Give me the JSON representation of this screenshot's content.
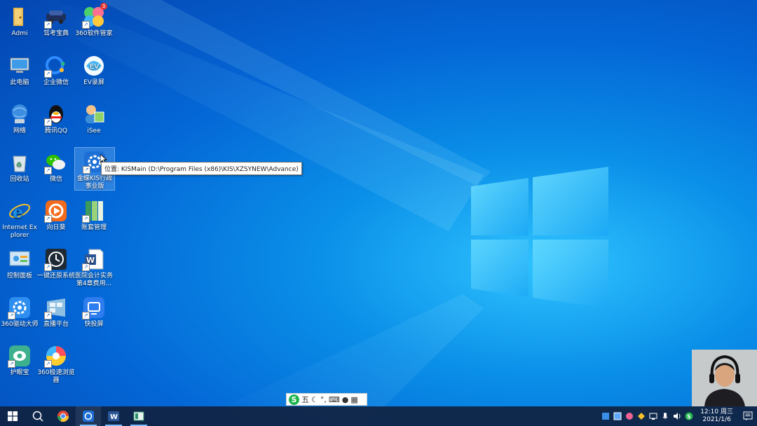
{
  "desktop": {
    "icons": [
      {
        "id": "admin",
        "label": "Admi"
      },
      {
        "id": "jiakao",
        "label": "驾考宝典"
      },
      {
        "id": "360manager",
        "label": "360软件管家",
        "badge": "3"
      },
      {
        "id": "thispc",
        "label": "此电脑"
      },
      {
        "id": "wecom",
        "label": "企业微信"
      },
      {
        "id": "ev",
        "label": "EV录屏"
      },
      {
        "id": "network",
        "label": "网络"
      },
      {
        "id": "qq",
        "label": "腾讯QQ"
      },
      {
        "id": "isee",
        "label": "iSee"
      },
      {
        "id": "recycle",
        "label": "回收站"
      },
      {
        "id": "wechat",
        "label": "微信"
      },
      {
        "id": "kis",
        "label": "金蝶KIS行政事业版"
      },
      {
        "id": "ie",
        "label": "Internet Explorer"
      },
      {
        "id": "xiangrikui",
        "label": "向日葵"
      },
      {
        "id": "zhangtao",
        "label": "账套管理"
      },
      {
        "id": "controlpanel",
        "label": "控制面板"
      },
      {
        "id": "restore",
        "label": "一键还原系统"
      },
      {
        "id": "worddoc",
        "label": "医院会计实务第4章费用..."
      },
      {
        "id": "360driver",
        "label": "360驱动大师"
      },
      {
        "id": "live",
        "label": "直播平台"
      },
      {
        "id": "kuaitou",
        "label": "快投屏"
      },
      {
        "id": "eyecare",
        "label": "护眼宝"
      },
      {
        "id": "360browser",
        "label": "360极速浏览器"
      }
    ]
  },
  "tooltip": {
    "text": "位置: KISMain (D:\\Program Files (x86)\\KIS\\XZSYNEW\\Advance)"
  },
  "ime": {
    "logo": "S",
    "mode": "五"
  },
  "taskbar": {
    "buttons": [
      {
        "id": "start",
        "icon": "windows-start-icon"
      },
      {
        "id": "search",
        "icon": "search-icon"
      },
      {
        "id": "chrome",
        "icon": "chrome-icon"
      },
      {
        "id": "kis",
        "icon": "kis-icon"
      },
      {
        "id": "word",
        "icon": "word-icon"
      },
      {
        "id": "app",
        "icon": "window-app-icon"
      }
    ]
  },
  "clock": {
    "time": "12:10 周三",
    "date": "2021/1/6"
  },
  "colors": {
    "desktop": "#0767d6",
    "taskbar": "#102240",
    "accent": "#7cc0ff"
  }
}
